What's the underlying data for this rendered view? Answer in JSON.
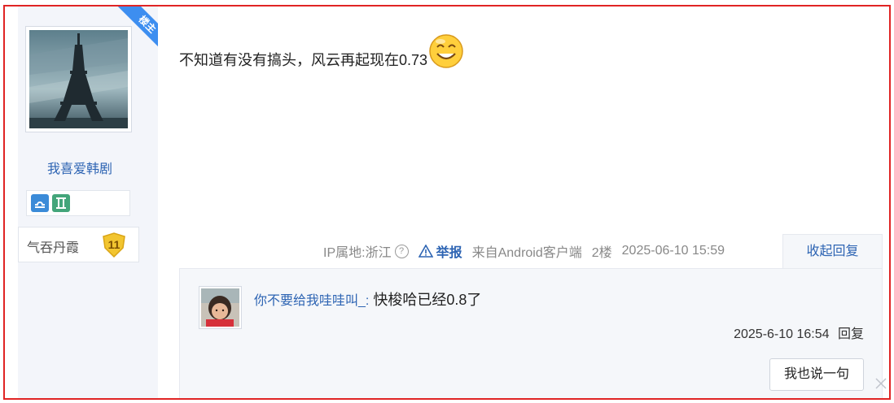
{
  "ribbon": {
    "label": "楼主"
  },
  "author": {
    "name": "我喜爱韩剧",
    "badges": [
      {
        "icon": "libra-icon",
        "color": "#3b8bd8"
      },
      {
        "icon": "gemini-icon",
        "color": "#43a57a"
      }
    ],
    "level_title": "气吞丹霞",
    "level_number": "11",
    "level_color": "#f2c530"
  },
  "post": {
    "text": "不知道有没有搞头，风云再起现在0.73",
    "emoji": "smile-emoji-icon"
  },
  "meta": {
    "ip_location": "IP属地:浙江",
    "help_symbol": "?",
    "report_label": "举报",
    "source": "来自Android客户端",
    "floor": "2楼",
    "timestamp": "2025-06-10 15:59",
    "collapse_label": "收起回复"
  },
  "reply": {
    "user": "你不要给我哇哇叫_",
    "separator": ":",
    "content": " 快梭哈已经0.8了",
    "timestamp": "2025-6-10 16:54",
    "reply_label": "回复",
    "say_button": "我也说一句"
  },
  "colors": {
    "frame_border": "#e02424",
    "link_blue": "#2d64b3",
    "ribbon_blue": "#3d8ef0",
    "sidebar_bg": "#f3f5fa"
  }
}
